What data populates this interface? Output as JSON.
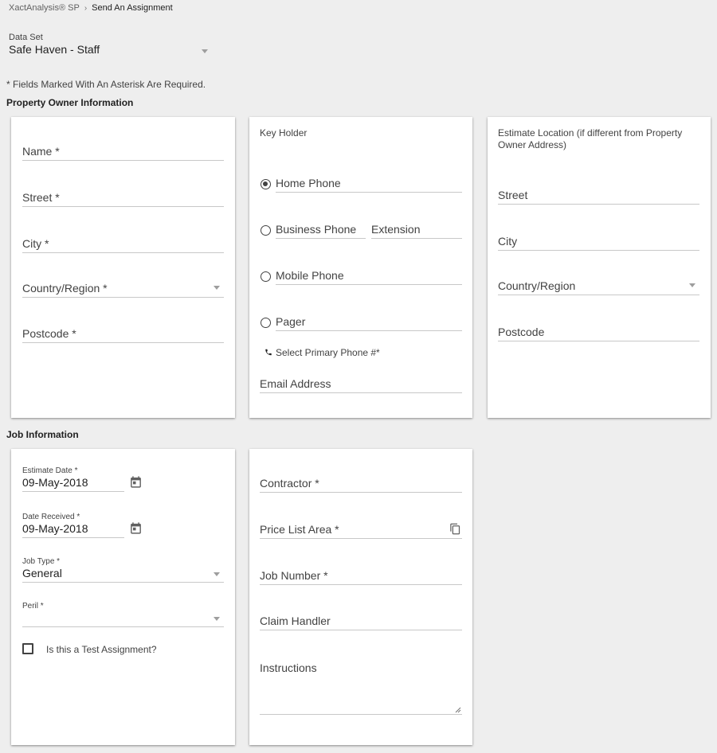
{
  "breadcrumb": {
    "root": "XactAnalysis® SP",
    "separator": "›",
    "current": "Send An Assignment"
  },
  "data_set": {
    "label": "Data Set",
    "value": "Safe Haven - Staff"
  },
  "required_note": "* Fields Marked With An Asterisk Are Required.",
  "property_owner": {
    "section_title": "Property Owner Information",
    "fields": {
      "name": "Name *",
      "street": "Street *",
      "city": "City *",
      "country": "Country/Region *",
      "postcode": "Postcode *"
    }
  },
  "key_holder": {
    "heading": "Key Holder",
    "phones": {
      "home": "Home Phone",
      "business": "Business Phone",
      "extension": "Extension",
      "mobile": "Mobile Phone",
      "pager": "Pager"
    },
    "selected_phone": "home",
    "primary_note": "Select Primary Phone #*",
    "email": "Email Address"
  },
  "estimate_location": {
    "heading": "Estimate Location (if different from Property Owner Address)",
    "fields": {
      "street": "Street",
      "city": "City",
      "country": "Country/Region",
      "postcode": "Postcode"
    }
  },
  "job": {
    "section_title": "Job Information",
    "estimate_date": {
      "label": "Estimate Date *",
      "value": "09-May-2018"
    },
    "date_received": {
      "label": "Date Received *",
      "value": "09-May-2018"
    },
    "job_type": {
      "label": "Job Type *",
      "value": "General"
    },
    "peril": {
      "label": "Peril *",
      "value": ""
    },
    "test_assignment": {
      "label": "Is this a Test Assignment?",
      "checked": false
    },
    "contractor": "Contractor *",
    "price_list_area": "Price List Area *",
    "job_number": "Job Number *",
    "claim_handler": "Claim Handler",
    "instructions": "Instructions"
  },
  "icons": {
    "calendar": "calendar-icon",
    "copy": "copy-icon",
    "phone": "phone-icon",
    "dropdown": "chevron-down-icon"
  }
}
